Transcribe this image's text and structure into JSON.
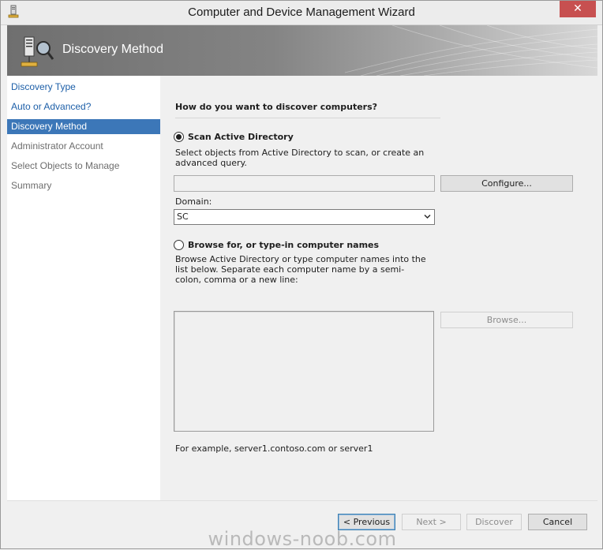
{
  "window": {
    "title": "Computer and Device Management Wizard",
    "close_glyph": "✕"
  },
  "banner": {
    "title": "Discovery Method"
  },
  "nav": {
    "items": [
      {
        "label": "Discovery Type",
        "state": "done"
      },
      {
        "label": "Auto or Advanced?",
        "state": "done"
      },
      {
        "label": "Discovery Method",
        "state": "active"
      },
      {
        "label": "Administrator Account",
        "state": "pending"
      },
      {
        "label": "Select Objects to Manage",
        "state": "pending"
      },
      {
        "label": "Summary",
        "state": "pending"
      }
    ]
  },
  "content": {
    "question": "How do you want to discover computers?",
    "scan": {
      "label": "Scan Active Directory",
      "selected": true,
      "description": "Select objects from Active Directory to scan, or create an advanced query.",
      "query_value": "",
      "configure_label": "Configure...",
      "domain_label": "Domain:",
      "domain_value": "SC"
    },
    "browse": {
      "label": "Browse for, or type-in computer names",
      "selected": false,
      "description": "Browse Active Directory or type computer names into the list below. Separate each computer name by a semi-colon, comma or a new line:",
      "browse_label": "Browse...",
      "example": "For example, server1.contoso.com or server1"
    }
  },
  "footer": {
    "previous_label": "< Previous",
    "next_label": "Next >",
    "discover_label": "Discover",
    "cancel_label": "Cancel"
  },
  "watermark": "windows-noob.com",
  "colors": {
    "active_nav": "#3c77b8",
    "done_nav": "#1d5fa8",
    "close": "#c75050"
  },
  "icons": {
    "app": "computer-tower-icon",
    "banner": "discovery-magnifier-icon",
    "dropdown": "chevron-down-icon"
  }
}
